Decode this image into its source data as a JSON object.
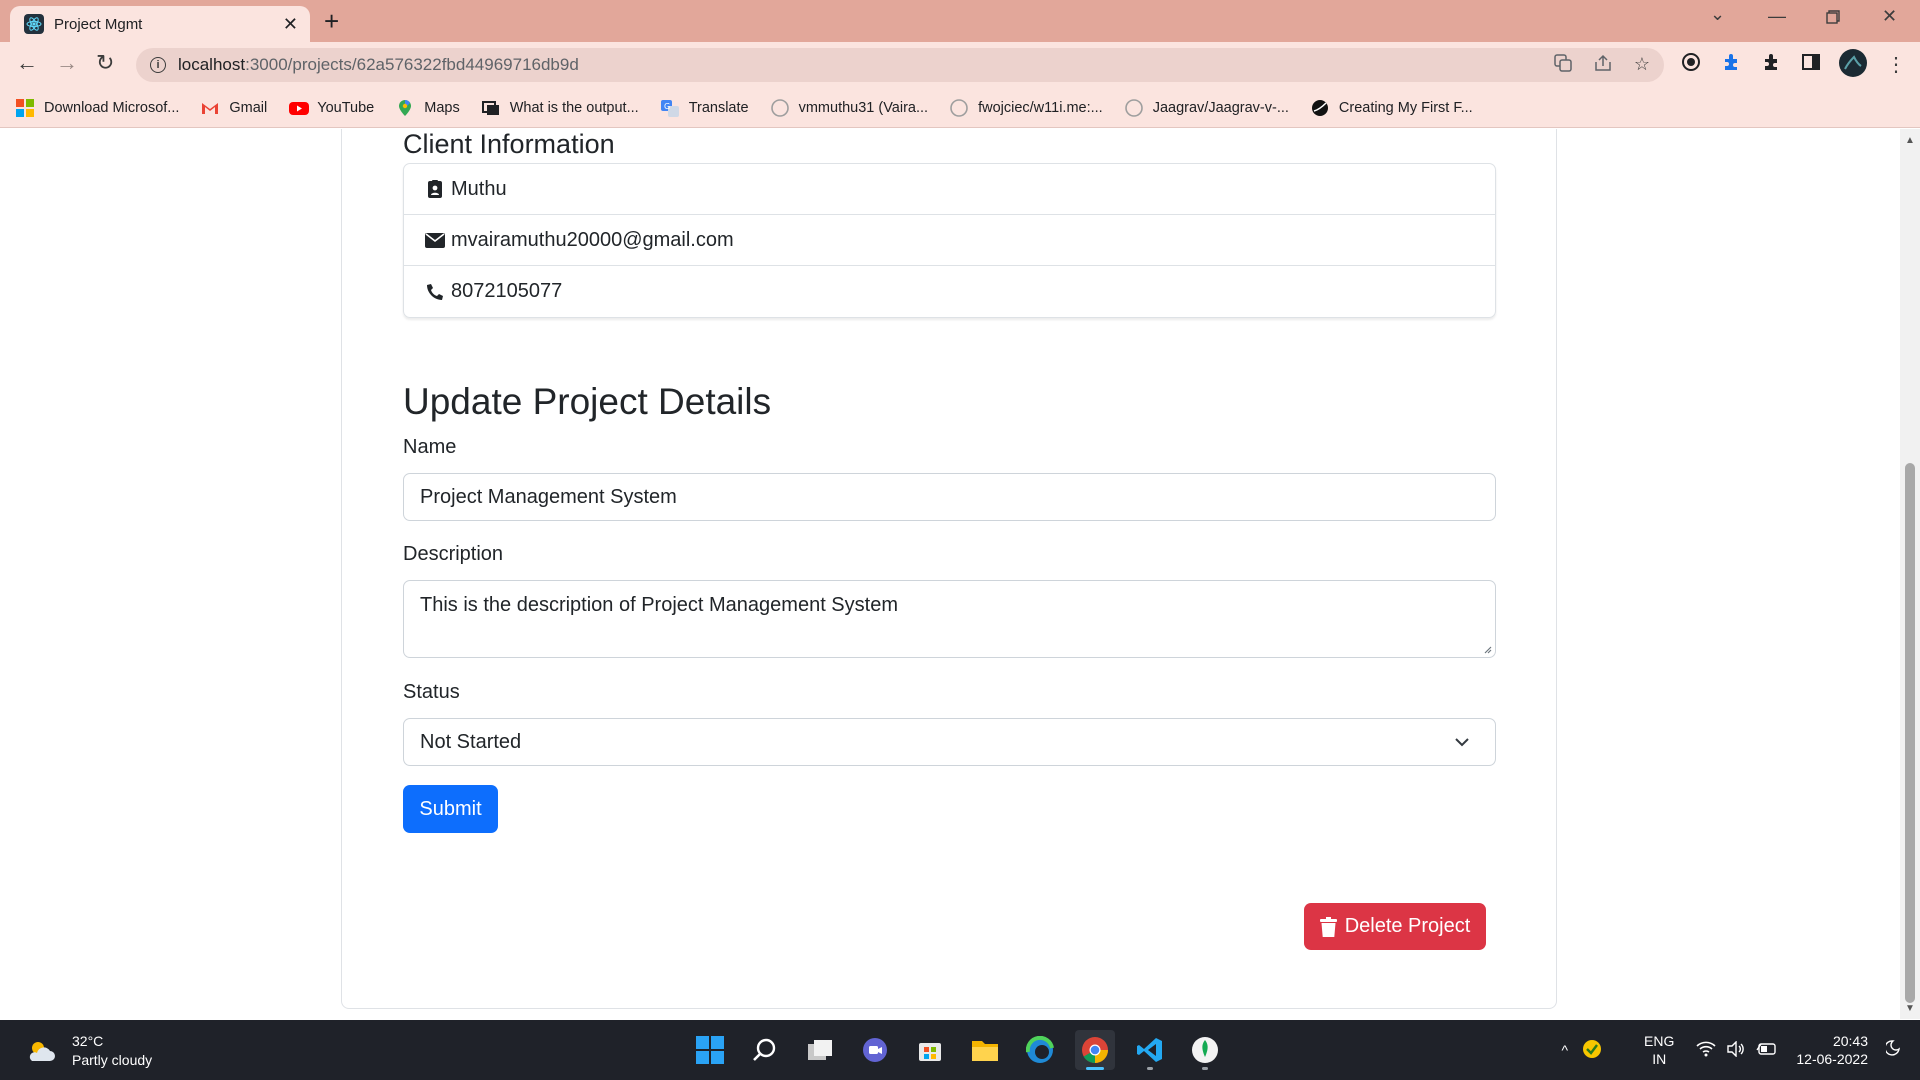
{
  "browser": {
    "tab_title": "Project Mgmt",
    "url_host": "localhost",
    "url_rest": ":3000/projects/62a576322fbd44969716db9d",
    "bookmarks": [
      {
        "label": "Download Microsof...",
        "icon": "windows-icon"
      },
      {
        "label": "Gmail",
        "icon": "gmail-icon"
      },
      {
        "label": "YouTube",
        "icon": "youtube-icon"
      },
      {
        "label": "Maps",
        "icon": "maps-icon"
      },
      {
        "label": "What is the output...",
        "icon": "page-icon"
      },
      {
        "label": "Translate",
        "icon": "translate-icon"
      },
      {
        "label": "vmmuthu31 (Vaira...",
        "icon": "github-icon"
      },
      {
        "label": "fwojciec/w11i.me:...",
        "icon": "github-icon"
      },
      {
        "label": "Jaagrav/Jaagrav-v-...",
        "icon": "github-icon"
      },
      {
        "label": "Creating My First F...",
        "icon": "globe-icon"
      }
    ]
  },
  "client": {
    "heading": "Client Information",
    "name": "Muthu",
    "email": "mvairamuthu20000@gmail.com",
    "phone": "8072105077"
  },
  "form": {
    "heading": "Update Project Details",
    "name_label": "Name",
    "name_value": "Project Management System",
    "description_label": "Description",
    "description_value": "This is the description of Project Management System",
    "status_label": "Status",
    "status_value": "Not Started",
    "submit_label": "Submit"
  },
  "delete_label": "Delete Project",
  "taskbar": {
    "temperature": "32°C",
    "weather": "Partly cloudy",
    "lang_top": "ENG",
    "lang_bottom": "IN",
    "time": "20:43",
    "date": "12-06-2022"
  },
  "colors": {
    "primary": "#0d6efd",
    "danger": "#dc3545",
    "tabstrip": "#e2a79a",
    "toolbar": "#fbe4df"
  }
}
